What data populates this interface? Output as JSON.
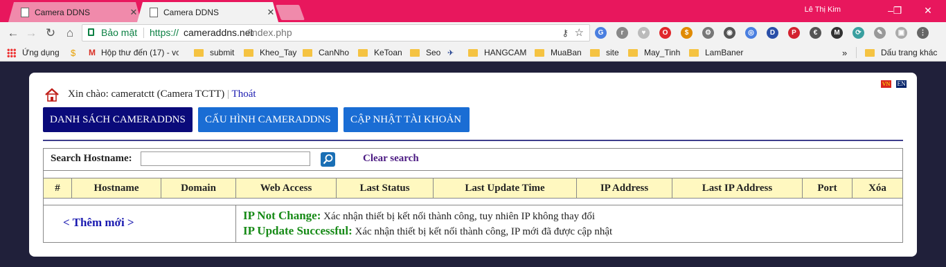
{
  "browser": {
    "tabs": [
      {
        "title": "Camera DDNS",
        "close": "✕"
      },
      {
        "title": "Camera DDNS",
        "close": "✕"
      }
    ],
    "user": "Lê Thị Kim",
    "window_controls": {
      "minimize": "–",
      "restore": "❐",
      "close": "✕"
    },
    "nav": {
      "back": "←",
      "forward": "→",
      "reload": "↻",
      "home": "⌂"
    },
    "omnibox": {
      "secure_label": "Bảo mật",
      "url_scheme": "https://",
      "url_host": "cameraddns.net",
      "url_path": "/index.php"
    },
    "extensions": [
      "G",
      "r",
      "♥",
      "O",
      "$",
      "⚙",
      "◉",
      "◎",
      "D",
      "P",
      "€",
      "M",
      "⟳",
      "✎",
      "▣",
      "⋮"
    ],
    "bookmarks": {
      "apps": "Ứng dụng",
      "items": [
        "Hộp thư đến (17) - vc",
        "submit",
        "Kheo_Tay",
        "CanNho",
        "KeToan",
        "Seo",
        "HANGCAM",
        "MuaBan",
        "site",
        "May_Tinh",
        "LamBaner"
      ],
      "overflow": "»",
      "other": "Dấu trang khác"
    }
  },
  "page": {
    "languages": [
      "VN",
      "EN"
    ],
    "greeting": {
      "text": "Xin chào: cameratctt (Camera TCTT)",
      "separator": "|",
      "logout": "Thoát"
    },
    "nav_tabs": [
      "DANH SÁCH CAMERADDNS",
      "CẤU HÌNH CAMERADDNS",
      "CẬP NHẬT TÀI KHOẢN"
    ],
    "search": {
      "label": "Search Hostname:",
      "value": "",
      "clear": "Clear search"
    },
    "table": {
      "columns": [
        "#",
        "Hostname",
        "Domain",
        "Web Access",
        "Last Status",
        "Last Update Time",
        "IP Address",
        "Last IP Address",
        "Port",
        "Xóa"
      ],
      "rows": []
    },
    "add_new": "< Thêm mới >",
    "legend": [
      {
        "key": "IP Not Change:",
        "text": "Xác nhận thiết bị kết nối thành công, tuy nhiên IP không thay đổi"
      },
      {
        "key": "IP Update Successful:",
        "text": "Xác nhận thiết bị kết nối thành công, IP mới đã được cập nhật"
      }
    ],
    "colors": {
      "page_background": "#20203a",
      "active_tab": "#0a0a7a",
      "tab": "#1a6dd4",
      "table_header": "#fff8c0",
      "status_green": "#168a16",
      "chrome_accent": "#e8175d"
    }
  }
}
